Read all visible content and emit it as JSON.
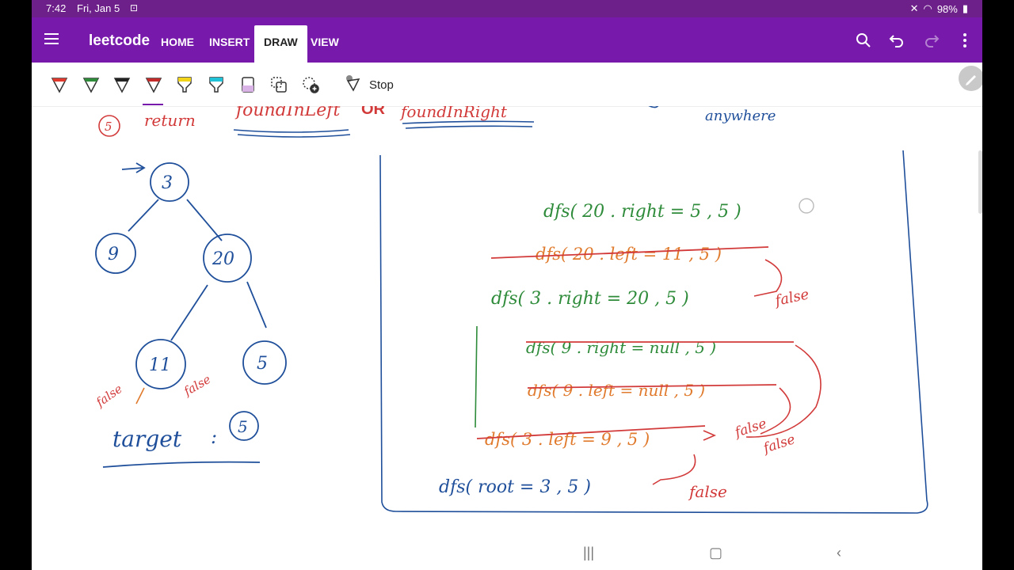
{
  "status": {
    "time": "7:42",
    "date": "Fri, Jan 5",
    "battery": "98%"
  },
  "app": {
    "title": "leetcode",
    "accent": "#7719aa"
  },
  "tabs": [
    {
      "label": "HOME"
    },
    {
      "label": "INSERT"
    },
    {
      "label": "DRAW",
      "active": true
    },
    {
      "label": "VIEW"
    }
  ],
  "toolbar": {
    "pens": [
      {
        "name": "pen-red",
        "color": "#e03a2e"
      },
      {
        "name": "pen-green",
        "color": "#2e8b3a"
      },
      {
        "name": "pen-black",
        "color": "#222222"
      },
      {
        "name": "pen-darkred",
        "color": "#c42b2b",
        "selected": true
      },
      {
        "name": "highlighter-yellow",
        "color": "#f2d51b"
      },
      {
        "name": "highlighter-cyan",
        "color": "#1fc2d6"
      },
      {
        "name": "eraser",
        "color": "#d9b3e6"
      },
      {
        "name": "lasso-select",
        "color": "#333333"
      },
      {
        "name": "add-pen",
        "color": "#333333"
      }
    ],
    "stop_label": "Stop"
  },
  "drawing": {
    "top_row": {
      "step": "5",
      "word": "return",
      "expr1": "foundInLeft",
      "op": "OR",
      "expr2": "foundInRight",
      "right_note": "anywhere"
    },
    "tree": {
      "root": "3",
      "left": "9",
      "right": "20",
      "rl": "11",
      "rr": "5",
      "false_left": "false",
      "false_right": "false",
      "target_label": "target",
      "target_value": "5"
    },
    "calls": {
      "c1": "dfs( 20 . right = 5 , 5 )",
      "c2": "dfs( 20 . left = 11 , 5 )",
      "c3": "dfs( 3 . right = 20 , 5 )",
      "c3_result": "false",
      "c4": "dfs( 9 . right = null , 5 )",
      "c5": "dfs( 9 . left = null , 5 )",
      "c6": "dfs( 3 . left = 9 , 5 )",
      "c6_result1": "false",
      "c6_result2": "false",
      "c7": "dfs( root = 3 , 5 )",
      "c7_result": "false"
    }
  }
}
